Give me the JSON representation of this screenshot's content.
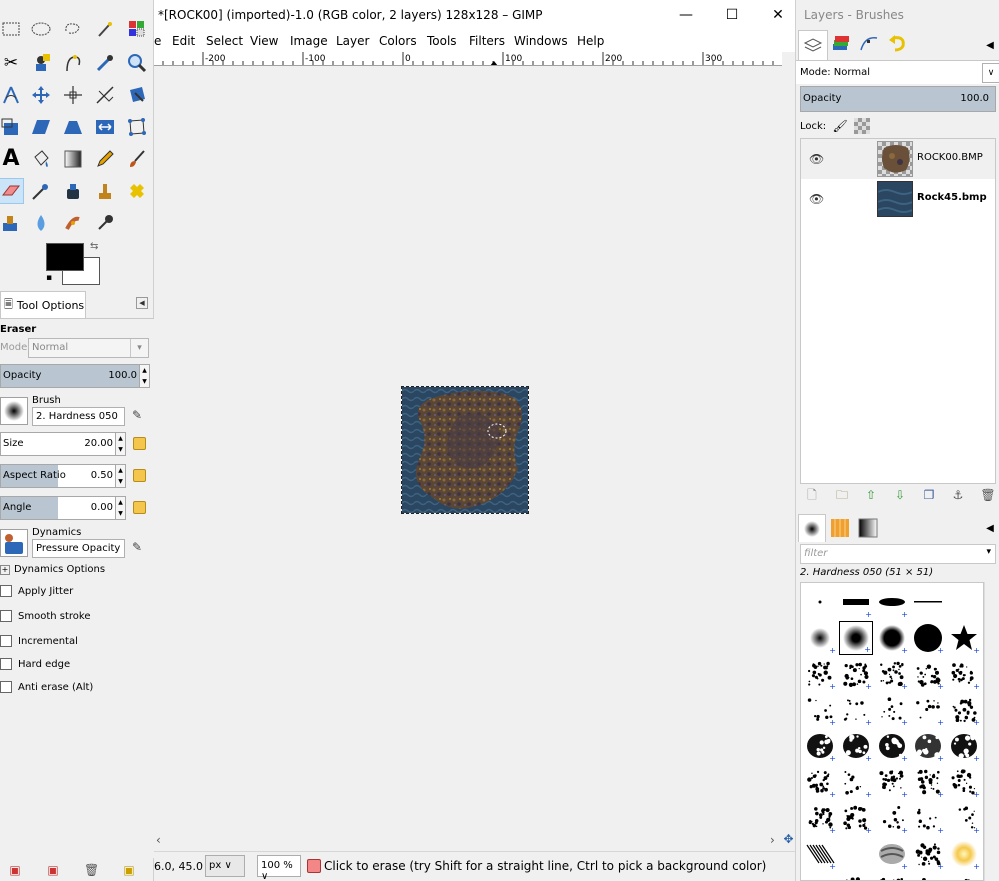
{
  "window": {
    "title": "*[ROCK00] (imported)-1.0 (RGB color, 2 layers) 128x128 – GIMP",
    "minimize": "—",
    "maximize": "☐",
    "close": "✕"
  },
  "menu": [
    "File",
    "Edit",
    "Select",
    "View",
    "Image",
    "Layer",
    "Colors",
    "Tools",
    "Filters",
    "Windows",
    "Help"
  ],
  "menu_visible": [
    "e",
    "Edit",
    "Select",
    "View",
    "Image",
    "Layer",
    "Colors",
    "Tools",
    "Filters",
    "Windows",
    "Help"
  ],
  "ruler": {
    "labels": [
      "-200",
      "-100",
      "0",
      "100",
      "200",
      "300"
    ]
  },
  "tool_options": {
    "tab_label": "Tool Options",
    "tool_name": "Eraser",
    "mode_label": "Mode:",
    "mode_value": "Normal",
    "opacity_label": "Opacity",
    "opacity_value": "100.0",
    "brush_label": "Brush",
    "brush_value": "2. Hardness 050",
    "size_label": "Size",
    "size_value": "20.00",
    "aspect_label": "Aspect Ratio",
    "aspect_value": "0.50",
    "angle_label": "Angle",
    "angle_value": "0.00",
    "dynamics_label": "Dynamics",
    "dynamics_value": "Pressure Opacity",
    "dynamics_options": "Dynamics Options",
    "checks": [
      "Apply Jitter",
      "Smooth stroke",
      "Incremental",
      "Hard edge",
      "Anti erase  (Alt)"
    ]
  },
  "status": {
    "coords": "6.0, 45.0",
    "unit": "px",
    "zoom": "100 %",
    "message": "Click to erase (try Shift for a straight line, Ctrl to pick a background color)"
  },
  "dock": {
    "title": "Layers - Brushes",
    "mode_label": "Mode: Normal",
    "opacity_label": "Opacity",
    "opacity_value": "100.0",
    "lock_label": "Lock:",
    "layers": [
      {
        "name": "ROCK00.BMP",
        "bold": false
      },
      {
        "name": "Rock45.bmp",
        "bold": true
      }
    ],
    "filter_placeholder": "filter",
    "brush_caption": "2. Hardness 050 (51 × 51)"
  },
  "colors": {
    "accent": "#cce4f7",
    "opacity_fill": "#b9c6d2",
    "fg": "#000000",
    "bg": "#ffffff"
  }
}
